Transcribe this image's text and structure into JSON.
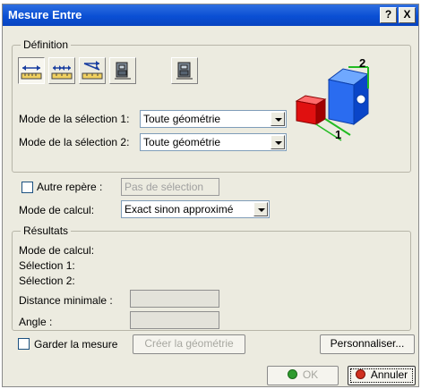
{
  "window": {
    "title": "Mesure Entre",
    "help_label": "?",
    "close_label": "X"
  },
  "definition": {
    "legend": "Définition",
    "tools": [
      {
        "icon": "measure-between-icon"
      },
      {
        "icon": "measure-chain-icon"
      },
      {
        "icon": "measure-fan-icon"
      },
      {
        "icon": "measure-item-icon"
      },
      {
        "icon": "measure-thickness-icon"
      }
    ],
    "selection1_label": "Mode de la sélection 1:",
    "selection1_value": "Toute géométrie",
    "selection2_label": "Mode de la sélection 2:",
    "selection2_value": "Toute géométrie",
    "preview_labels": {
      "one": "1",
      "two": "2"
    }
  },
  "options": {
    "other_axis_label": "Autre repère :",
    "other_axis_placeholder": "Pas de sélection",
    "calc_mode_label": "Mode de calcul:",
    "calc_mode_value": "Exact sinon approximé"
  },
  "results": {
    "legend": "Résultats",
    "calc_mode_label": "Mode de calcul:",
    "selection1_label": "Sélection 1:",
    "selection2_label": "Sélection 2:",
    "min_distance_label": "Distance minimale :",
    "min_distance_value": "",
    "angle_label": "Angle :",
    "angle_value": ""
  },
  "footer": {
    "keep_measure_label": "Garder la mesure",
    "create_geometry_label": "Créer la géométrie",
    "customize_label": "Personnaliser...",
    "ok_label": "OK",
    "cancel_label": "Annuler"
  },
  "colors": {
    "title_bar": "#0a4fd4",
    "ok_dot": "#2e9b2e",
    "cancel_dot": "#d03020"
  }
}
